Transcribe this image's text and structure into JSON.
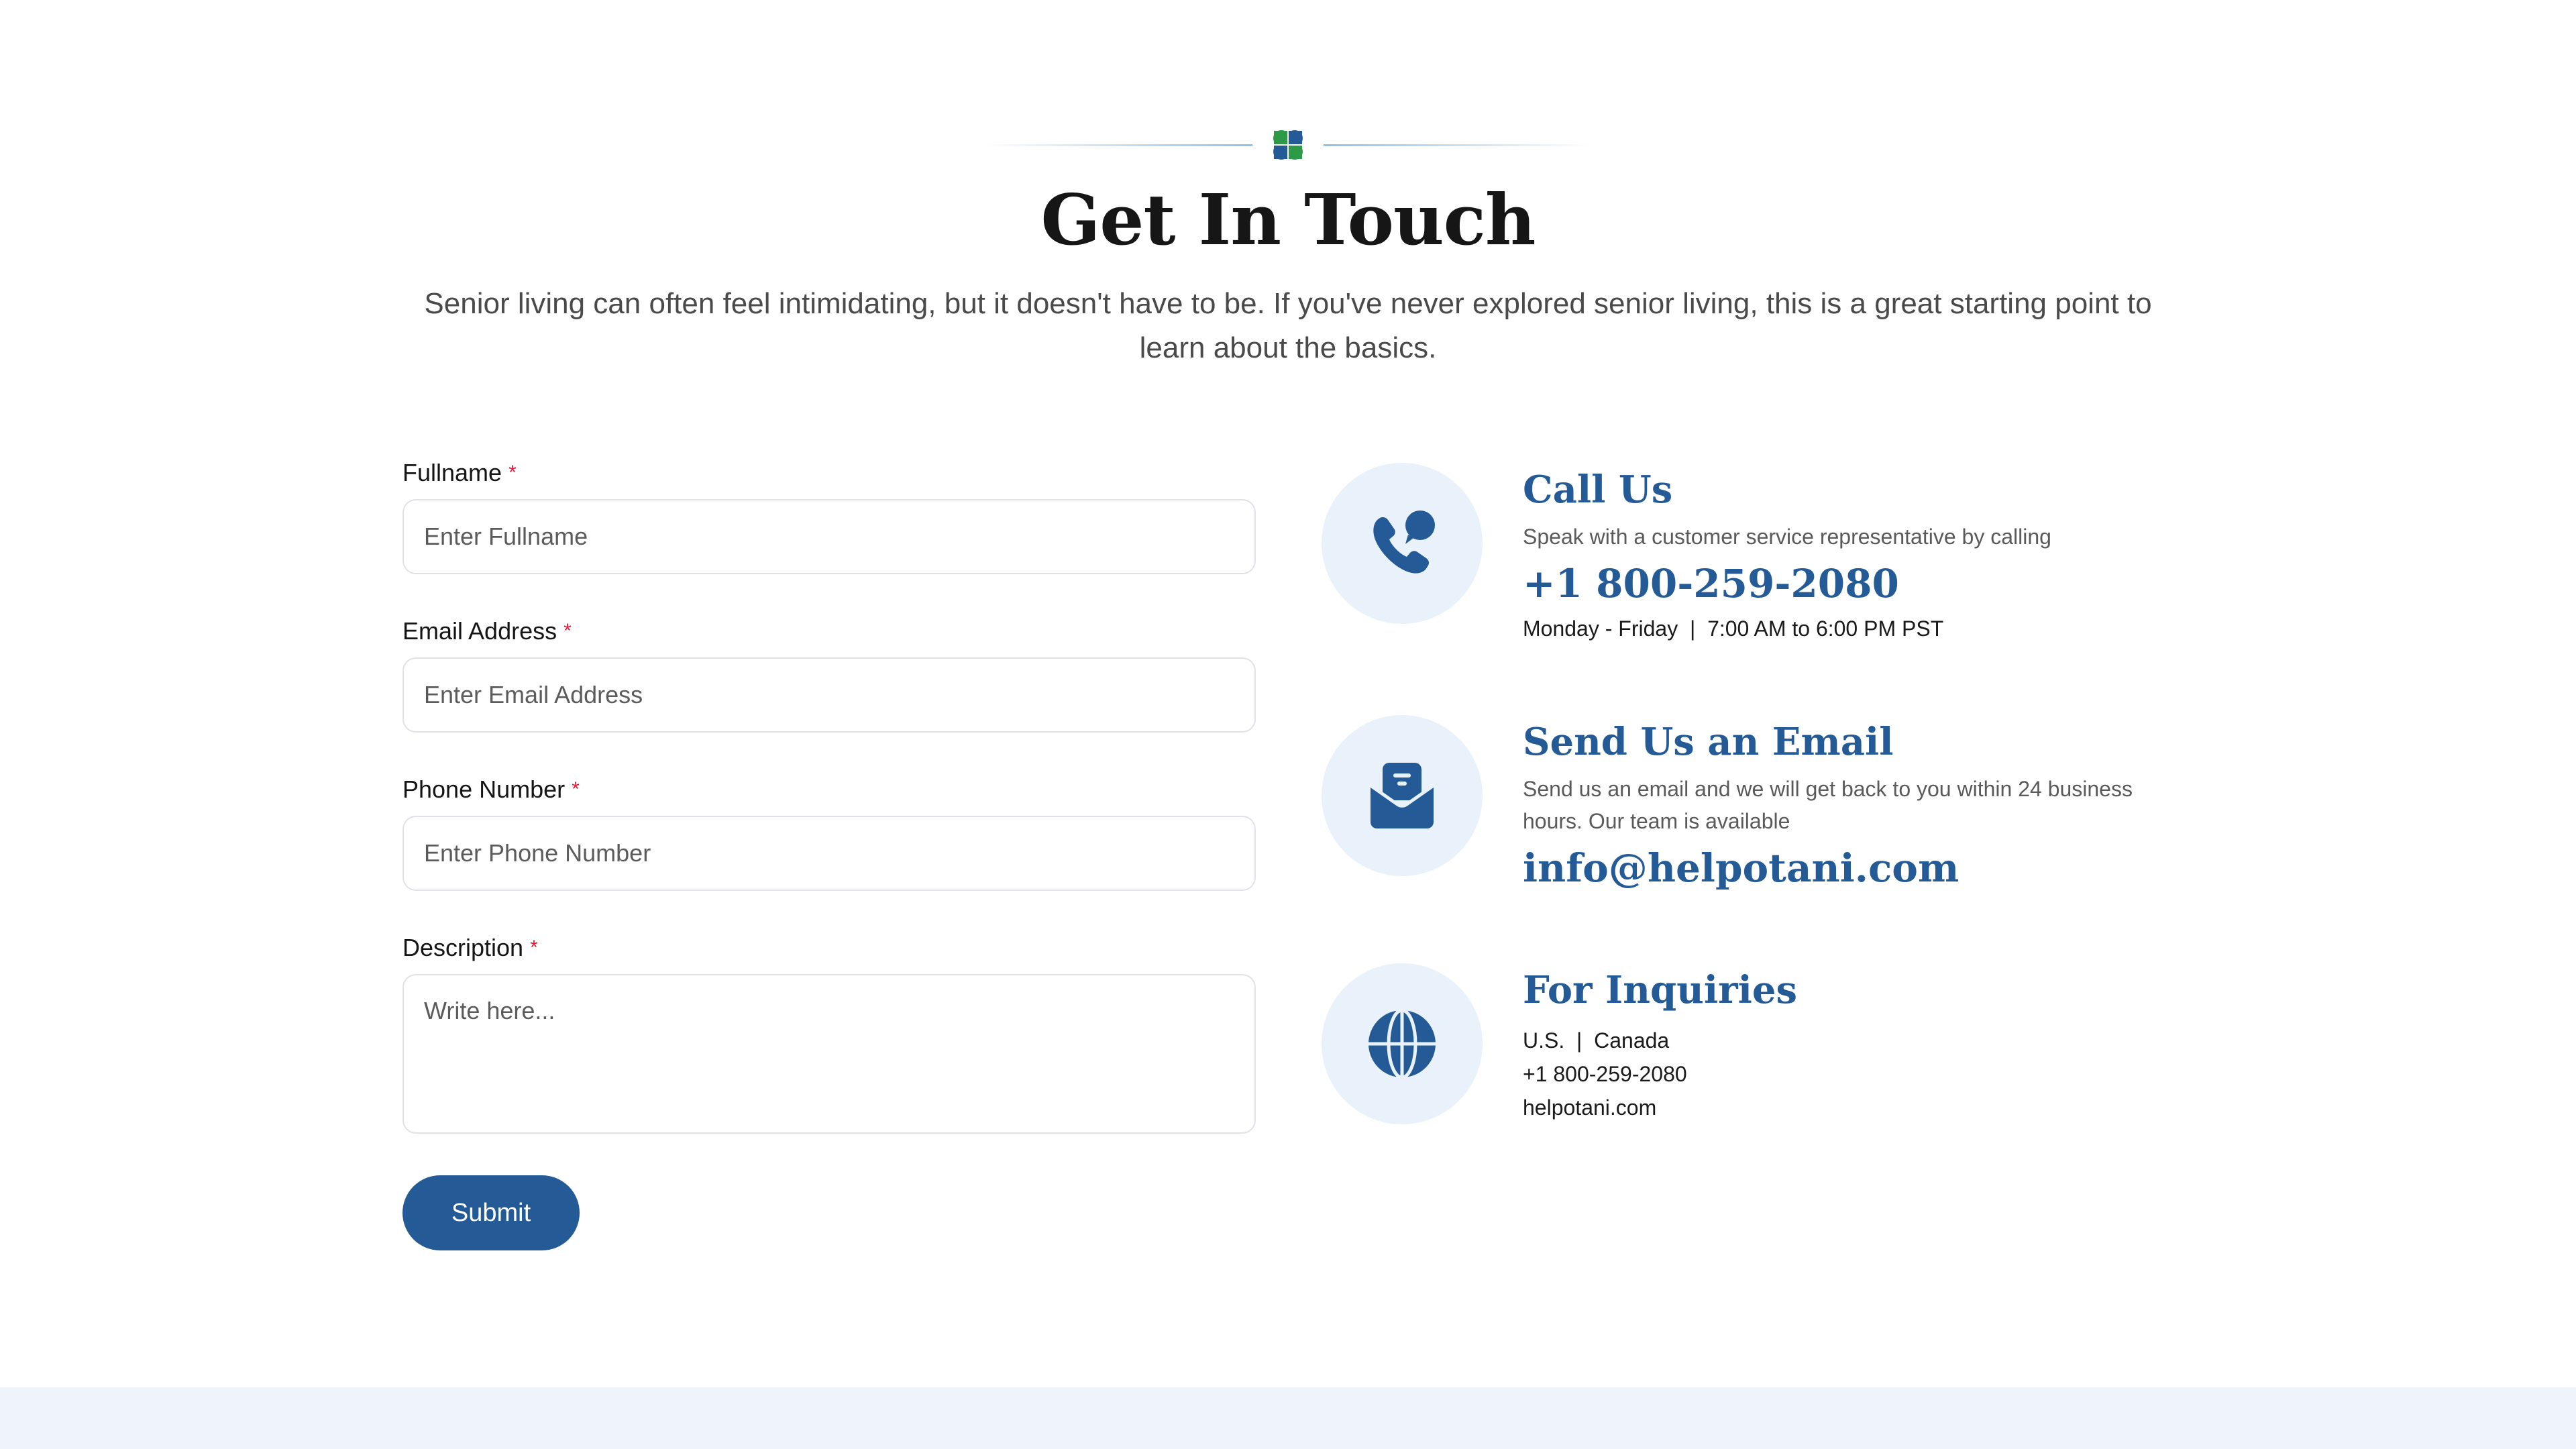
{
  "header": {
    "title": "Get In Touch",
    "subtitle": "Senior living can often feel intimidating, but it doesn't have to be. If you've never explored senior living, this is a great starting point to learn about the basics."
  },
  "form": {
    "fullname": {
      "label": "Fullname",
      "required": "*",
      "placeholder": "Enter Fullname",
      "value": ""
    },
    "email": {
      "label": "Email Address",
      "required": "*",
      "placeholder": "Enter Email Address",
      "value": ""
    },
    "phone": {
      "label": "Phone Number",
      "required": "*",
      "placeholder": "Enter Phone Number",
      "value": ""
    },
    "description": {
      "label": "Description",
      "required": "*",
      "placeholder": "Write here...",
      "value": ""
    },
    "submit_label": "Submit"
  },
  "contact": {
    "call": {
      "icon": "phone-chat-icon",
      "title": "Call Us",
      "desc": "Speak with a customer service  representative by calling",
      "phone": "+1 800-259-2080",
      "hours": "Monday - Friday  |  7:00 AM to 6:00 PM PST"
    },
    "email": {
      "icon": "mail-icon",
      "title": "Send Us an Email",
      "desc": "Send us an email and we will get back to you within 24 business hours. Our team is available",
      "address": "info@helpotani.com"
    },
    "inquiries": {
      "icon": "globe-icon",
      "title": "For Inquiries",
      "regions": "U.S.  |  Canada",
      "phone": "+1 800-259-2080",
      "website": "helpotani.com"
    }
  },
  "colors": {
    "brand_blue": "#245b96",
    "icon_bg": "#e9f1fa",
    "required": "#e0203a",
    "footer_band": "#eff3fa"
  }
}
